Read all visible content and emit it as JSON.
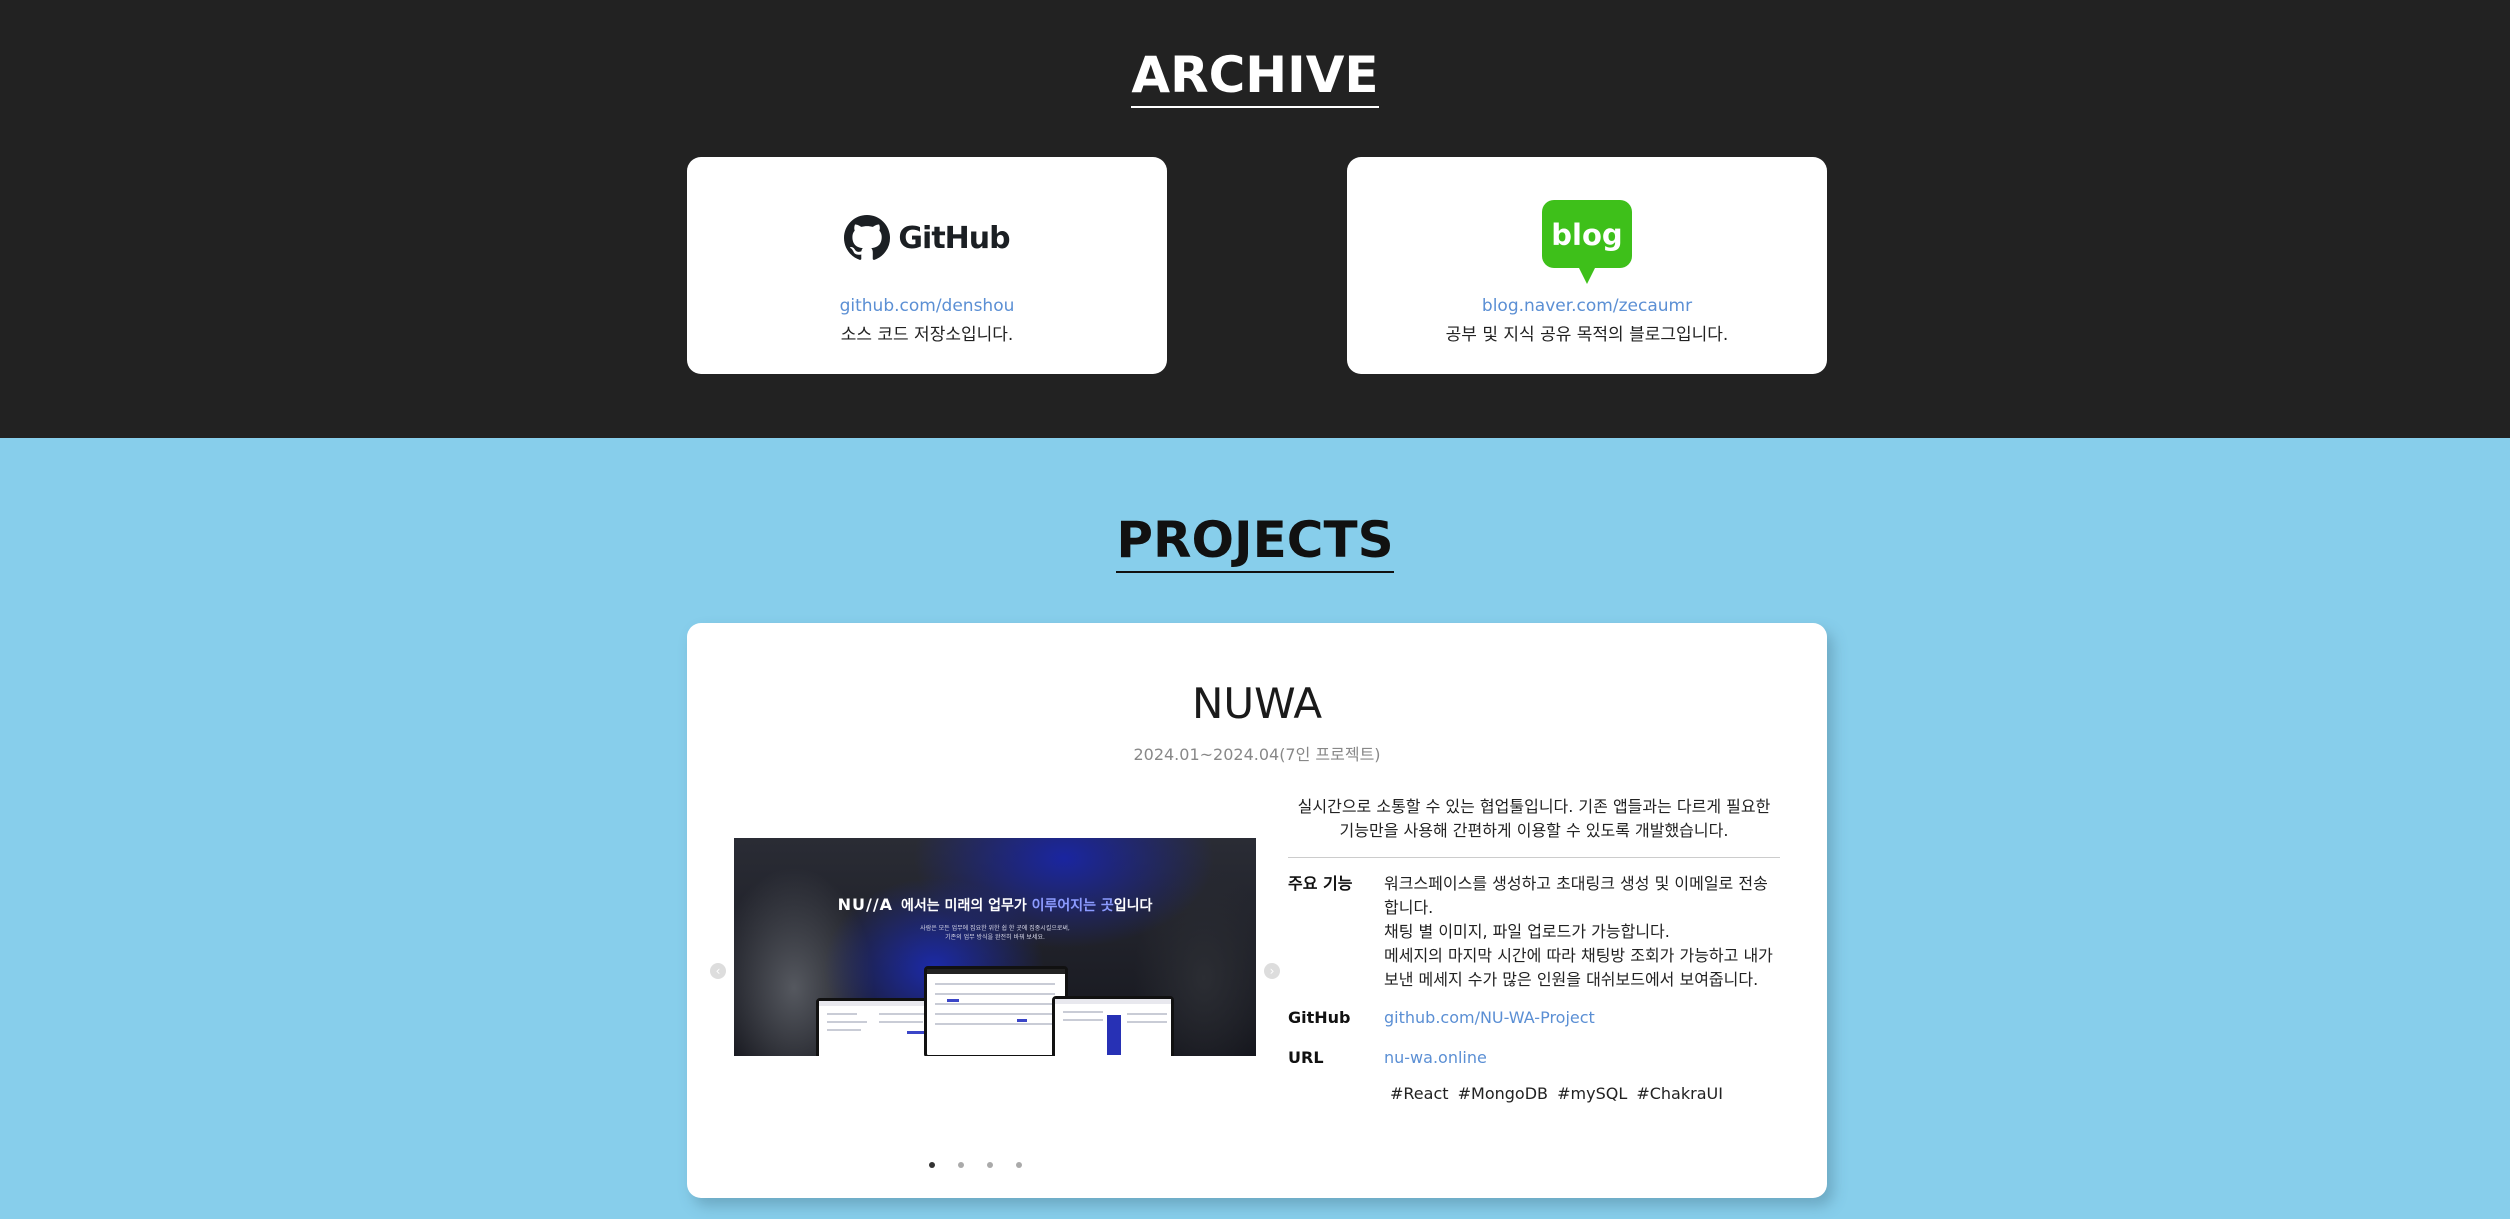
{
  "archive": {
    "title": "ARCHIVE",
    "cards": [
      {
        "logo": "github-logo",
        "logo_text": "GitHub",
        "link": "github.com/denshou",
        "description": "소스 코드 저장소입니다."
      },
      {
        "logo": "naver-blog-logo",
        "logo_text": "blog",
        "link": "blog.naver.com/zecaumr",
        "description": "공부 및 지식 공유 목적의 블로그입니다."
      }
    ]
  },
  "projects": {
    "title": "PROJECTS",
    "current": {
      "name": "NUWA",
      "period": "2024.01~2024.04(7인 프로젝트)",
      "slide": {
        "brand": "NU//A",
        "headline_before": "에서는 미래의 업무가 ",
        "headline_accent": "이루어지는 곳",
        "headline_after": "입니다",
        "sub_line_1": "사람은 모든 업무에 집요한 위한 쉽 한 곳에 집중시킬으로써,",
        "sub_line_2": "기존의 업무 방식을 완전히 바꿔 보세요."
      },
      "intro": "실시간으로 소통할 수 있는 협업툴입니다. 기존 앱들과는 다르게 필요한 기능만을 사용해 간편하게 이용할 수 있도록 개발했습니다.",
      "features_label": "주요 기능",
      "features": [
        "워크스페이스를 생성하고 초대링크 생성 및 이메일로 전송합니다.",
        "채팅 별 이미지, 파일 업로드가 가능합니다.",
        "메세지의 마지막 시간에 따라 채팅방 조회가 가능하고 내가 보낸 메세지 수가 많은 인원을 대쉬보드에서 보여줍니다."
      ],
      "github_label": "GitHub",
      "github_link": "github.com/NU-WA-Project",
      "url_label": "URL",
      "url_link": "nu-wa.online",
      "tags": [
        "#React",
        "#MongoDB",
        "#mySQL",
        "#ChakraUI"
      ],
      "slide_count": 4,
      "active_slide": 1
    }
  },
  "colors": {
    "archive_bg": "#222222",
    "projects_bg": "#87ceeb",
    "link": "#5b8fd4",
    "naver_green": "#3ec01a"
  },
  "icons": {
    "prev": "chevron-left-icon",
    "next": "chevron-right-icon"
  }
}
